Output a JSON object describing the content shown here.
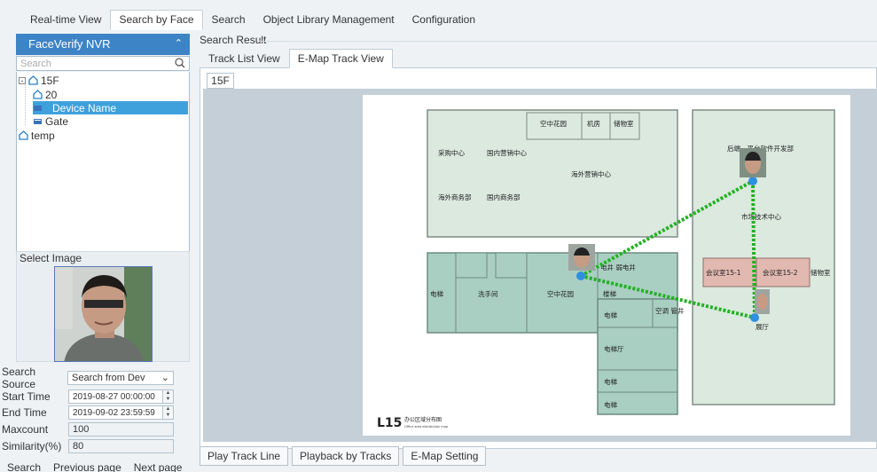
{
  "top_tabs": [
    "Real-time View",
    "Search by Face",
    "Search",
    "Object Library Management",
    "Configuration"
  ],
  "active_top_tab": "Search by Face",
  "left_panel": {
    "title": "FaceVerify NVR",
    "search_placeholder": "Search",
    "tree": {
      "root": "15F",
      "children": [
        "20",
        "Device Name",
        "Gate"
      ],
      "other_root": "temp",
      "selected": "Device Name"
    },
    "select_image_label": "Select Image",
    "form": {
      "search_source_label": "Search Source",
      "search_source_value": "Search from Dev",
      "start_time_label": "Start Time",
      "start_time_value": "2019-08-27 00:00:00",
      "end_time_label": "End Time",
      "end_time_value": "2019-09-02 23:59:59",
      "maxcount_label": "Maxcount",
      "maxcount_value": "100",
      "similarity_label": "Similarity(%)",
      "similarity_value": "80"
    },
    "buttons": [
      "Search",
      "Previous page",
      "Next page"
    ]
  },
  "main": {
    "search_result_label": "Search Result",
    "sub_tabs": [
      "Track List View",
      "E-Map Track View"
    ],
    "active_sub_tab": "E-Map Track View",
    "floor_tab": "15F",
    "map": {
      "rooms": [
        "空中花园",
        "机房",
        "储物室",
        "采购中心",
        "国内营销中心",
        "海外营销中心",
        "海外商务部",
        "国内商务部",
        "后端、平台软件开发部",
        "市场技术中心",
        "电梯",
        "洗手间",
        "空中花园",
        "电井 弱电井",
        "楼梯",
        "电梯",
        "空调\n管井",
        "电梯厅",
        "电梯",
        "电梯",
        "会议室15-1",
        "会议室15-2",
        "储物室",
        "展厅"
      ],
      "legend_title": "L15",
      "legend_cn": "办公区域分布图",
      "legend_en": "Office area distribution map"
    },
    "track_color": "#22b122",
    "bottom_buttons": [
      "Play Track Line",
      "Playback by Tracks",
      "E-Map Setting"
    ]
  },
  "colors": {
    "accent": "#3d84c6",
    "selected": "#3fa1dc",
    "room_green": "#dbe9df",
    "room_teal": "#a9cfc2",
    "meeting": "#e2b9b0"
  }
}
